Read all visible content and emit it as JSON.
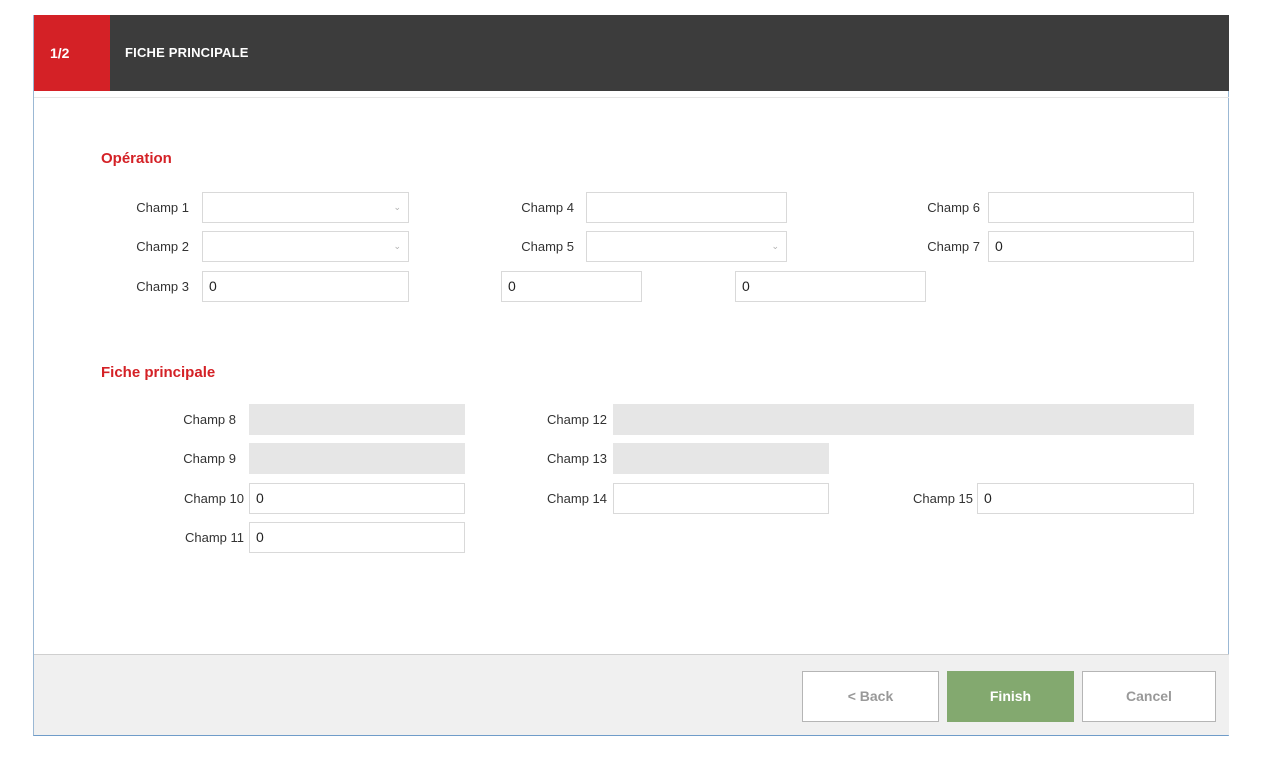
{
  "header": {
    "step": "1/2",
    "title": "FICHE PRINCIPALE"
  },
  "sections": {
    "operation": {
      "title": "Opération",
      "champ1": {
        "label": "Champ 1",
        "value": ""
      },
      "champ2": {
        "label": "Champ 2",
        "value": ""
      },
      "champ3": {
        "label": "Champ 3",
        "value": "0"
      },
      "champ3b": {
        "value": "0"
      },
      "champ3c": {
        "value": "0"
      },
      "champ4": {
        "label": "Champ 4",
        "value": ""
      },
      "champ5": {
        "label": "Champ 5",
        "value": ""
      },
      "champ6": {
        "label": "Champ 6",
        "value": ""
      },
      "champ7": {
        "label": "Champ 7",
        "value": "0"
      }
    },
    "fiche": {
      "title": "Fiche principale",
      "champ8": {
        "label": "Champ 8",
        "value": ""
      },
      "champ9": {
        "label": "Champ 9",
        "value": ""
      },
      "champ10": {
        "label": "Champ 10",
        "value": "0"
      },
      "champ11": {
        "label": "Champ 11",
        "value": "0"
      },
      "champ12": {
        "label": "Champ 12",
        "value": ""
      },
      "champ13": {
        "label": "Champ 13",
        "value": ""
      },
      "champ14": {
        "label": "Champ 14",
        "value": ""
      },
      "champ15": {
        "label": "Champ 15",
        "value": "0"
      }
    }
  },
  "footer": {
    "back": "< Back",
    "finish": "Finish",
    "cancel": "Cancel"
  },
  "icons": {
    "dropdown": "chevron-down-icon"
  },
  "colors": {
    "accent": "#d42126",
    "header_bg": "#3c3c3c",
    "finish_bg": "#83a96f",
    "readonly_bg": "#e6e6e6"
  }
}
